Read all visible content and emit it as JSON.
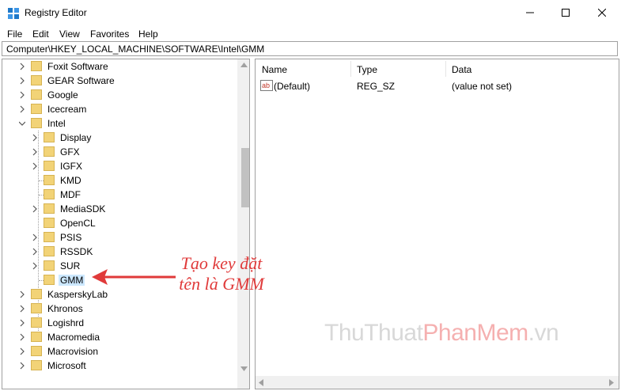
{
  "window": {
    "title": "Registry Editor"
  },
  "menu": [
    "File",
    "Edit",
    "View",
    "Favorites",
    "Help"
  ],
  "address": "Computer\\HKEY_LOCAL_MACHINE\\SOFTWARE\\Intel\\GMM",
  "tree": {
    "items": [
      {
        "label": "Foxit Software"
      },
      {
        "label": "GEAR Software"
      },
      {
        "label": "Google"
      },
      {
        "label": "Icecream"
      },
      {
        "label": "Intel"
      },
      {
        "label": "Display"
      },
      {
        "label": "GFX"
      },
      {
        "label": "IGFX"
      },
      {
        "label": "KMD"
      },
      {
        "label": "MDF"
      },
      {
        "label": "MediaSDK"
      },
      {
        "label": "OpenCL"
      },
      {
        "label": "PSIS"
      },
      {
        "label": "RSSDK"
      },
      {
        "label": "SUR"
      },
      {
        "label": "GMM"
      },
      {
        "label": "KasperskyLab"
      },
      {
        "label": "Khronos"
      },
      {
        "label": "Logishrd"
      },
      {
        "label": "Macromedia"
      },
      {
        "label": "Macrovision"
      },
      {
        "label": "Microsoft"
      }
    ]
  },
  "list": {
    "columns": [
      "Name",
      "Type",
      "Data"
    ],
    "rows": [
      {
        "name": "(Default)",
        "type": "REG_SZ",
        "data": "(value not set)"
      }
    ]
  },
  "annotation": {
    "line1": "Tạo key đặt",
    "line2": "tên là GMM"
  },
  "watermark": {
    "part1": "ThuThuat",
    "part2": "PhanMem",
    "part3": ".vn"
  },
  "colors": {
    "accent": "#e03a3a",
    "selection": "#cce8ff",
    "folder": "#f2d377"
  }
}
